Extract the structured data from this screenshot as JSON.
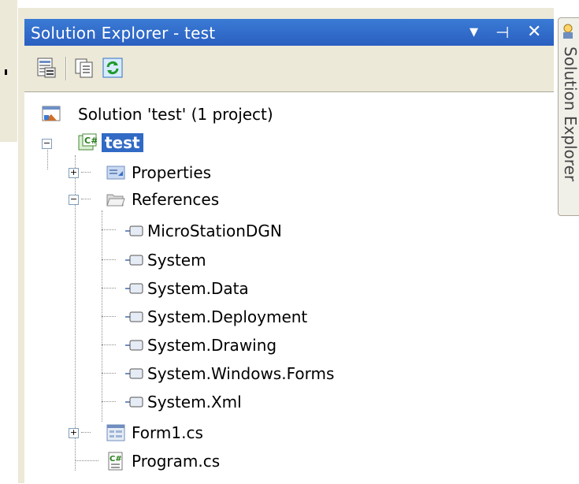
{
  "window": {
    "title": "Solution Explorer - test",
    "controls": {
      "dropdown": "▾",
      "pin": "⊣",
      "close": "✕"
    }
  },
  "toolbar": {
    "buttons": [
      {
        "name": "properties-icon"
      },
      {
        "name": "show-all-files-icon"
      },
      {
        "name": "refresh-icon"
      }
    ]
  },
  "side_tab": {
    "label": "Solution Explorer"
  },
  "tree": {
    "solution": "Solution 'test' (1 project)",
    "project": "test",
    "properties": "Properties",
    "references": "References",
    "references_items": [
      "MicroStationDGN",
      "System",
      "System.Data",
      "System.Deployment",
      "System.Drawing",
      "System.Windows.Forms",
      "System.Xml"
    ],
    "form1": "Form1.cs",
    "program": "Program.cs"
  },
  "colors": {
    "titlebar": "#2a5fc0",
    "selection": "#316ac5",
    "panel_bg": "#ece9d8"
  }
}
